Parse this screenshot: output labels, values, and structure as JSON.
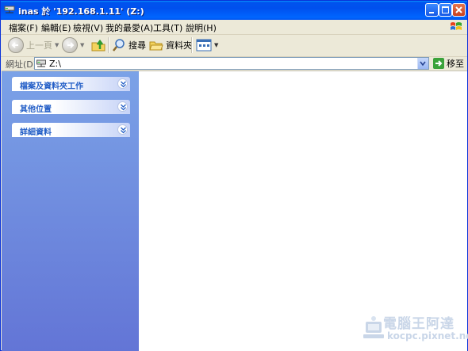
{
  "window": {
    "title": "inas 於 '192.168.1.11' (Z:)",
    "minimize_label": "",
    "maximize_label": "",
    "close_label": ""
  },
  "menu": {
    "items": [
      {
        "label": "檔案(F)"
      },
      {
        "label": "編輯(E)"
      },
      {
        "label": "檢視(V)"
      },
      {
        "label": "我的最愛(A)"
      },
      {
        "label": "工具(T)"
      },
      {
        "label": "說明(H)"
      }
    ]
  },
  "toolbar": {
    "back_label": "上一頁",
    "search_label": "搜尋",
    "folders_label": "資料夾"
  },
  "address": {
    "label": "網址(D)",
    "value": "Z:\\",
    "go_label": "移至"
  },
  "taskpane": {
    "groups": [
      {
        "title": "檔案及資料夾工作"
      },
      {
        "title": "其他位置"
      },
      {
        "title": "詳細資料"
      }
    ]
  },
  "watermark": {
    "line1": "電腦王阿達",
    "line2": "kocpc.pixnet.net"
  },
  "colors": {
    "titlebar": "#0054e3",
    "close": "#d5481f",
    "taskpane_top": "#7ba2e7",
    "taskpane_bottom": "#6375d6",
    "group_title": "#215dc6"
  }
}
